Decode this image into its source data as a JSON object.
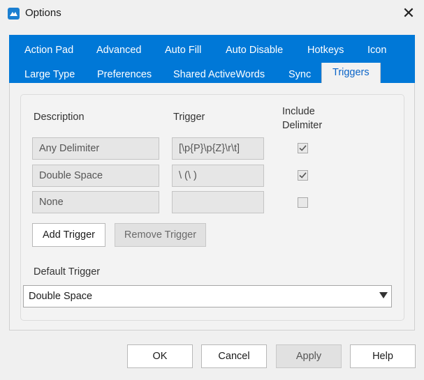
{
  "window": {
    "title": "Options",
    "app_icon": "activewords-logo-icon",
    "close_glyph": "✕"
  },
  "tabs": {
    "row1": [
      "Action Pad",
      "Advanced",
      "Auto Fill",
      "Auto Disable",
      "Hotkeys",
      "Icon"
    ],
    "row2": [
      "Large Type",
      "Preferences",
      "Shared ActiveWords",
      "Sync",
      "Triggers"
    ],
    "active": "Triggers"
  },
  "triggers": {
    "headers": {
      "description": "Description",
      "trigger": "Trigger",
      "include_delimiter": "Include\nDelimiter"
    },
    "rows": [
      {
        "description": "Any Delimiter",
        "trigger": "[\\p{P}\\p{Z}\\r\\t]",
        "include_delimiter": true
      },
      {
        "description": "Double Space",
        "trigger": "\\ (\\ )",
        "include_delimiter": true
      },
      {
        "description": "None",
        "trigger": "",
        "include_delimiter": false
      }
    ],
    "add_label": "Add Trigger",
    "remove_label": "Remove Trigger",
    "default_label": "Default Trigger",
    "default_value": "Double Space"
  },
  "footer": {
    "ok": "OK",
    "cancel": "Cancel",
    "apply": "Apply",
    "help": "Help"
  },
  "colors": {
    "accent": "#0078d7",
    "active_tab_text": "#0a64c8"
  }
}
